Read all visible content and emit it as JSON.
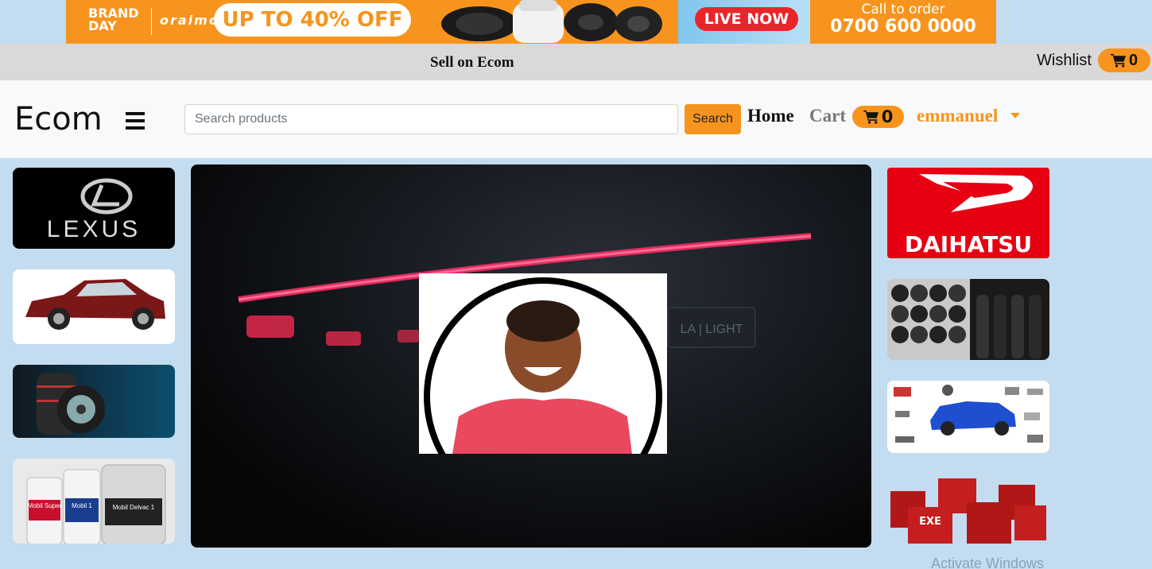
{
  "promo": {
    "brand_line1": "BRAND",
    "brand_line2": "DAY",
    "partner": "oraimo",
    "offer": "UP TO 40% OFF",
    "live": "LIVE NOW",
    "call_label": "Call to order",
    "call_number": "0700 600 0000"
  },
  "topbar": {
    "sell": "Sell on Ecom",
    "wishlist": "Wishlist",
    "wishlist_count": "0"
  },
  "navbar": {
    "logo": "Ecom",
    "search_placeholder": "Search products",
    "search_button": "Search",
    "home": "Home",
    "cart": "Cart",
    "cart_count": "0",
    "user": "emmanuel"
  },
  "left_tiles": {
    "lexus": "LEXUS"
  },
  "right_tiles": {
    "daihatsu": "DAIHATSU",
    "battery_brand": "EXE"
  },
  "oil_labels": [
    "Mobil Super",
    "Mobil 1",
    "Mobil Delvac 1"
  ],
  "hero_plate": "LA | LIGHT",
  "watermark": "Activate Windows",
  "colors": {
    "accent": "#f7941d",
    "background": "#c4dcef",
    "topbar": "#d9d9d9",
    "navbar": "#f8f9fa",
    "daihatsu_red": "#e60012"
  }
}
